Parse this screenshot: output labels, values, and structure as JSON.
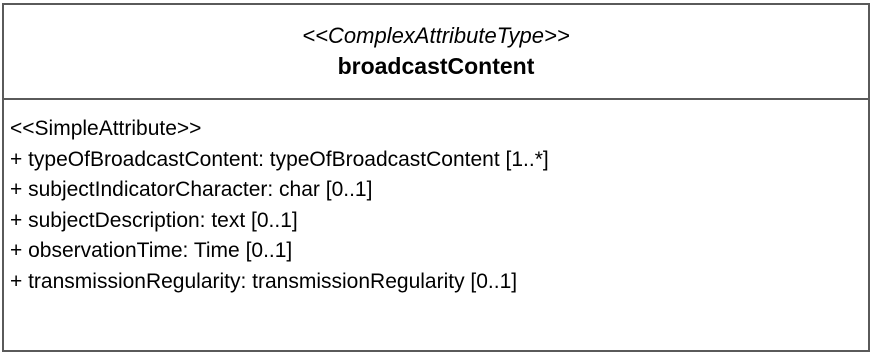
{
  "class_box": {
    "stereotype": "<<ComplexAttributeType>>",
    "name": "broadcastContent"
  },
  "attributes": {
    "stereotype": "<<SimpleAttribute>>",
    "items": [
      "+ typeOfBroadcastContent: typeOfBroadcastContent [1..*]",
      "+ subjectIndicatorCharacter: char [0..1]",
      "+ subjectDescription: text [0..1]",
      "+ observationTime: Time [0..1]",
      "+ transmissionRegularity: transmissionRegularity [0..1]"
    ]
  }
}
